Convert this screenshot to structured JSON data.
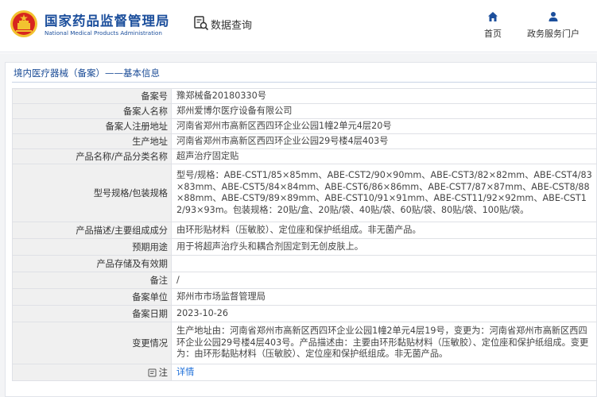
{
  "header": {
    "logo_cn": "国家药品监督管理局",
    "logo_en": "National Medical Products Administration",
    "query_label": "数据查询",
    "nav": [
      {
        "label": "首页",
        "icon": "home-icon"
      },
      {
        "label": "政务服务门户",
        "icon": "user-icon"
      }
    ]
  },
  "breadcrumb": "境内医疗器械（备案）——基本信息",
  "rows": [
    {
      "label": "备案号",
      "value": "豫郑械备20180330号"
    },
    {
      "label": "备案人名称",
      "value": "郑州爱博尔医疗设备有限公司"
    },
    {
      "label": "备案人注册地址",
      "value": "河南省郑州市高新区西四环企业公园1幢2单元4层20号"
    },
    {
      "label": "生产地址",
      "value": "河南省郑州市高新区西四环企业公园29号楼4层403号"
    },
    {
      "label": "产品名称/产品分类名称",
      "value": "超声治疗固定贴"
    },
    {
      "label": "型号规格/包装规格",
      "value": "型号/规格：ABE-CST1/85×85mm、ABE-CST2/90×90mm、ABE-CST3/82×82mm、ABE-CST4/83×83mm、ABE-CST5/84×84mm、ABE-CST6/86×86mm、ABE-CST7/87×87mm、ABE-CST8/88×88mm、ABE-CST9/89×89mm、ABE-CST10/91×91mm、ABE-CST11/92×92mm、ABE-CST12/93×93m。包装规格：20贴/盒、20贴/袋、40贴/袋、60贴/袋、80贴/袋、100贴/袋。"
    },
    {
      "label": "产品描述/主要组成成分",
      "value": "由环形贴材料（压敏胶）、定位座和保护纸组成。非无菌产品。"
    },
    {
      "label": "预期用途",
      "value": "用于将超声治疗头和耦合剂固定到无创皮肤上。"
    },
    {
      "label": "产品存储及有效期",
      "value": ""
    },
    {
      "label": "备注",
      "value": "/"
    },
    {
      "label": "备案单位",
      "value": "郑州市市场监督管理局"
    },
    {
      "label": "备案日期",
      "value": "2023-10-26"
    },
    {
      "label": "变更情况",
      "value": "生产地址由：河南省郑州市高新区西四环企业公园1幢2单元4层19号，变更为：河南省郑州市高新区西四环企业公园29号楼4层403号。产品描述由：主要由环形黏贴材料（压敏胶）、定位座和保护纸组成。变更为：由环形黏贴材料（压敏胶）、定位座和保护纸组成。非无菌产品。"
    },
    {
      "label": "注",
      "value": "详情",
      "icon": "note-icon"
    }
  ],
  "colors": {
    "brand": "#1c4f9c",
    "link": "#1e6fd9",
    "label_bg": "#f0f0f0",
    "emblem_red": "#d7261e",
    "emblem_gold": "#f2c230"
  }
}
